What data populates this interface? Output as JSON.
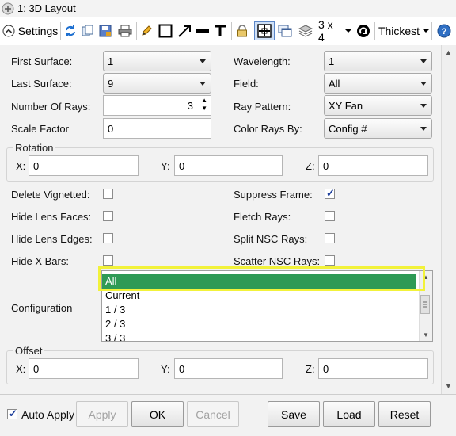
{
  "window": {
    "title": "1: 3D Layout"
  },
  "toolbar": {
    "settings_label": "Settings",
    "layout_label": "3 x 4",
    "line_label": "Thickest"
  },
  "form": {
    "first_surface": {
      "label": "First Surface:",
      "value": "1"
    },
    "last_surface": {
      "label": "Last Surface:",
      "value": "9"
    },
    "num_rays": {
      "label": "Number Of Rays:",
      "value": "3"
    },
    "scale_factor": {
      "label": "Scale Factor",
      "value": "0"
    },
    "wavelength": {
      "label": "Wavelength:",
      "value": "1"
    },
    "field": {
      "label": "Field:",
      "value": "All"
    },
    "ray_pattern": {
      "label": "Ray Pattern:",
      "value": "XY Fan"
    },
    "color_rays_by": {
      "label": "Color Rays By:",
      "value": "Config #"
    }
  },
  "rotation": {
    "title": "Rotation",
    "x_label": "X:",
    "x_value": "0",
    "y_label": "Y:",
    "y_value": "0",
    "z_label": "Z:",
    "z_value": "0"
  },
  "checkboxes": {
    "delete_vignetted": {
      "label": "Delete Vignetted:",
      "checked": false
    },
    "hide_lens_faces": {
      "label": "Hide Lens Faces:",
      "checked": false
    },
    "hide_lens_edges": {
      "label": "Hide Lens Edges:",
      "checked": false
    },
    "hide_x_bars": {
      "label": "Hide X Bars:",
      "checked": false
    },
    "suppress_frame": {
      "label": "Suppress Frame:",
      "checked": true
    },
    "fletch_rays": {
      "label": "Fletch Rays:",
      "checked": false
    },
    "split_nsc_rays": {
      "label": "Split NSC Rays:",
      "checked": false
    },
    "scatter_nsc_rays": {
      "label": "Scatter NSC Rays:",
      "checked": false
    }
  },
  "configuration": {
    "label": "Configuration",
    "items": [
      "All",
      "Current",
      "1 / 3",
      "2 / 3",
      "3 / 3"
    ],
    "selected": "All"
  },
  "offset": {
    "title": "Offset",
    "x_label": "X:",
    "x_value": "0",
    "y_label": "Y:",
    "y_value": "0",
    "z_label": "Z:",
    "z_value": "0"
  },
  "bottom": {
    "auto_apply_label": "Auto Apply",
    "auto_apply_checked": true,
    "apply_label": "Apply",
    "ok_label": "OK",
    "cancel_label": "Cancel",
    "save_label": "Save",
    "load_label": "Load",
    "reset_label": "Reset"
  },
  "colors": {
    "selection": "#2e9a55",
    "highlight": "#f2f23a"
  }
}
